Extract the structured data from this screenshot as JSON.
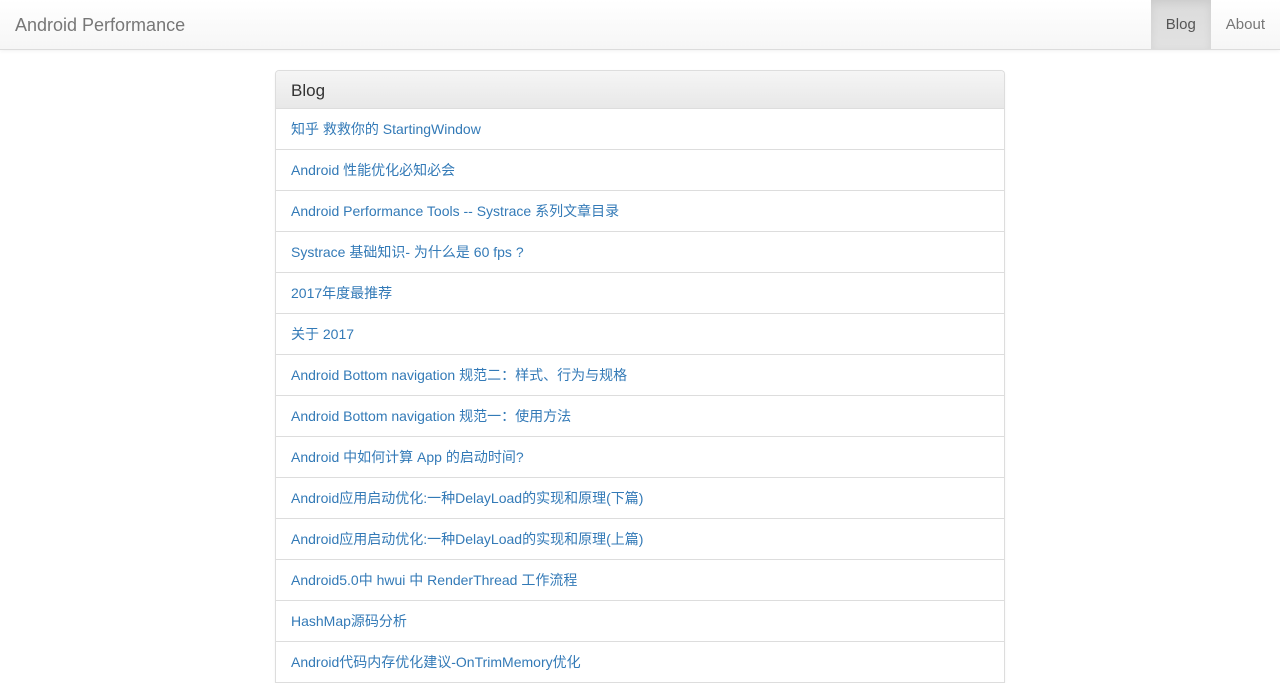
{
  "navbar": {
    "brand": "Android Performance",
    "links": [
      {
        "label": "Blog",
        "active": true
      },
      {
        "label": "About",
        "active": false
      }
    ]
  },
  "panel": {
    "title": "Blog",
    "posts": [
      "知乎 救救你的 StartingWindow",
      "Android 性能优化必知必会",
      "Android Performance Tools -- Systrace 系列文章目录",
      "Systrace 基础知识- 为什么是 60 fps ?",
      "2017年度最推荐",
      "关于 2017",
      "Android Bottom navigation 规范二：样式、行为与规格",
      "Android Bottom navigation 规范一：使用方法",
      "Android 中如何计算 App 的启动时间?",
      "Android应用启动优化:一种DelayLoad的实现和原理(下篇)",
      "Android应用启动优化:一种DelayLoad的实现和原理(上篇)",
      "Android5.0中 hwui 中 RenderThread 工作流程",
      "HashMap源码分析",
      "Android代码内存优化建议-OnTrimMemory优化"
    ]
  }
}
